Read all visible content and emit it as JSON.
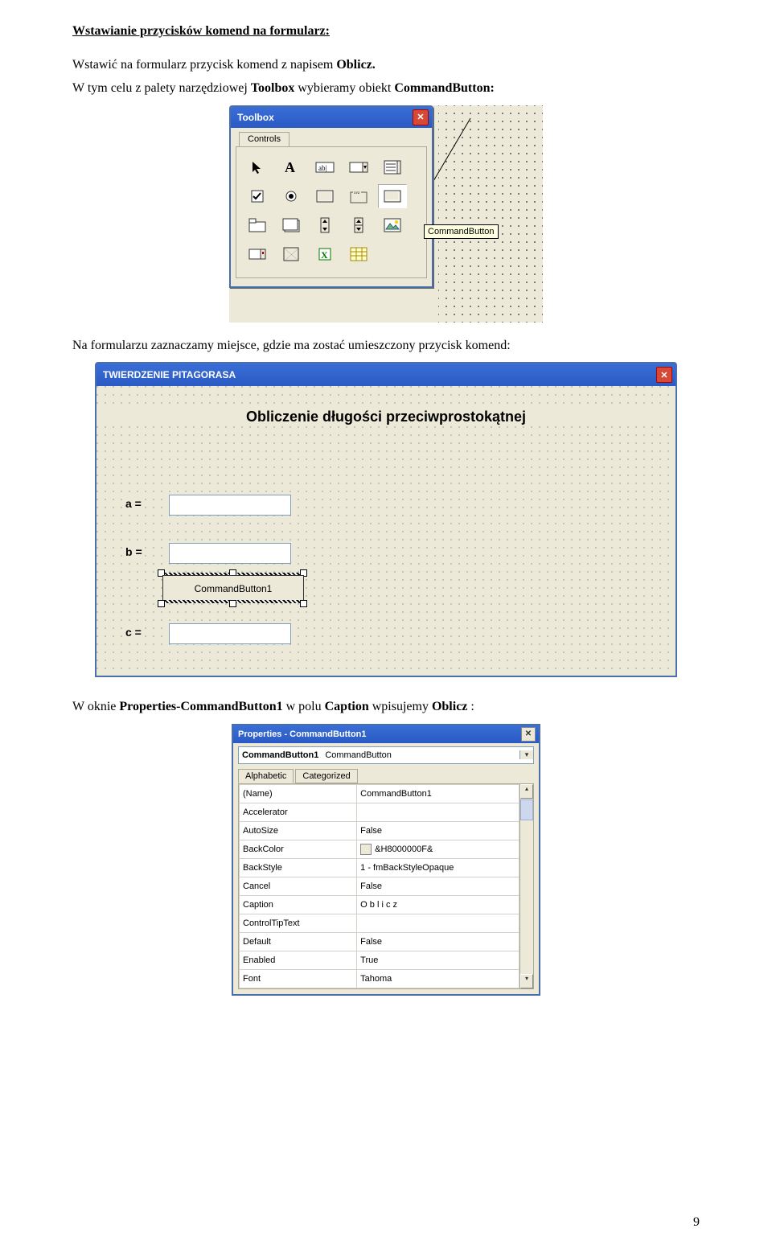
{
  "heading": "Wstawianie przycisków komend na formularz:",
  "intro": {
    "p1_pre": "Wstawić na formularz przycisk komend z napisem ",
    "p1_bold": "Oblicz.",
    "p2_pre": "W tym celu z palety narzędziowej ",
    "p2_b1": "Toolbox",
    "p2_mid": " wybieramy obiekt  ",
    "p2_b2": "CommandButton:"
  },
  "toolbox": {
    "title": "Toolbox",
    "tab": "Controls",
    "tooltip": "CommandButton"
  },
  "para2": "Na formularzu zaznaczamy miejsce, gdzie ma zostać umieszczony przycisk komend:",
  "form": {
    "title": "TWIERDZENIE PITAGORASA",
    "heading": "Obliczenie długości przeciwprostokątnej",
    "labels": {
      "a": "a =",
      "b": "b =",
      "c": "c ="
    },
    "button": "CommandButton1"
  },
  "para3": {
    "pre": "W oknie ",
    "b1": "Properties-CommandButton1",
    "mid": " w polu ",
    "b2": "Caption",
    "mid2": " wpisujemy ",
    "b3": "Oblicz",
    "end": " :"
  },
  "props": {
    "title": "Properties - CommandButton1",
    "combo": {
      "name": "CommandButton1",
      "type": "CommandButton"
    },
    "tabs": {
      "t1": "Alphabetic",
      "t2": "Categorized"
    },
    "rows": [
      {
        "k": "(Name)",
        "v": "CommandButton1"
      },
      {
        "k": "Accelerator",
        "v": ""
      },
      {
        "k": "AutoSize",
        "v": "False"
      },
      {
        "k": "BackColor",
        "v": "&H8000000F&",
        "swatch": true
      },
      {
        "k": "BackStyle",
        "v": "1 - fmBackStyleOpaque"
      },
      {
        "k": "Cancel",
        "v": "False"
      },
      {
        "k": "Caption",
        "v": "O b l i c z"
      },
      {
        "k": "ControlTipText",
        "v": ""
      },
      {
        "k": "Default",
        "v": "False"
      },
      {
        "k": "Enabled",
        "v": "True"
      },
      {
        "k": "Font",
        "v": "Tahoma"
      }
    ]
  },
  "page_number": "9"
}
